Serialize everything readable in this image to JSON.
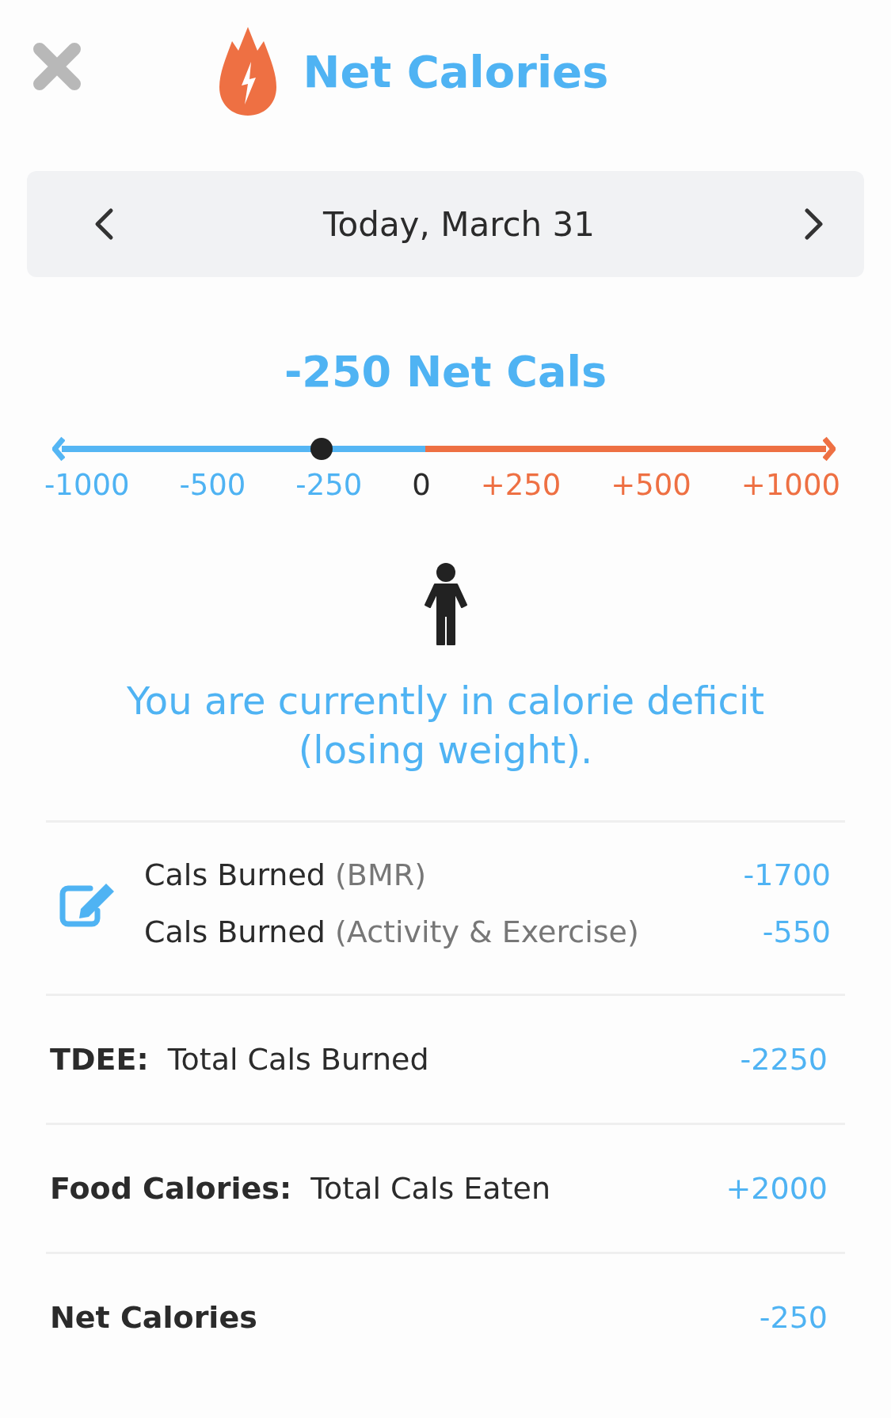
{
  "header": {
    "title": "Net Calories"
  },
  "date_nav": {
    "label": "Today, March 31"
  },
  "summary": {
    "headline": "-250 Net Cals",
    "scale": {
      "level": 0.34
    },
    "ticks": [
      {
        "label": "-1000",
        "color": "#4fb3f3"
      },
      {
        "label": "-500",
        "color": "#4fb3f3"
      },
      {
        "label": "-250",
        "color": "#4fb3f3"
      },
      {
        "label": "0",
        "color": "#2b2b2b"
      },
      {
        "label": "+250",
        "color": "#ee7043"
      },
      {
        "label": "+500",
        "color": "#ee7043"
      },
      {
        "label": "+1000",
        "color": "#ee7043"
      }
    ],
    "message": "You are currently in calorie deficit (losing weight)."
  },
  "burned": [
    {
      "label": "Cals Burned",
      "note": "(BMR)",
      "value": "-1700"
    },
    {
      "label": "Cals Burned",
      "note": "(Activity & Exercise)",
      "value": "-550"
    }
  ],
  "totals": [
    {
      "term": "TDEE:",
      "label": "Total Cals Burned",
      "value": "-2250"
    },
    {
      "term": "Food Calories:",
      "label": "Total Cals Eaten",
      "value": "+2000"
    },
    {
      "term": "Net Calories",
      "value": "-250"
    }
  ]
}
